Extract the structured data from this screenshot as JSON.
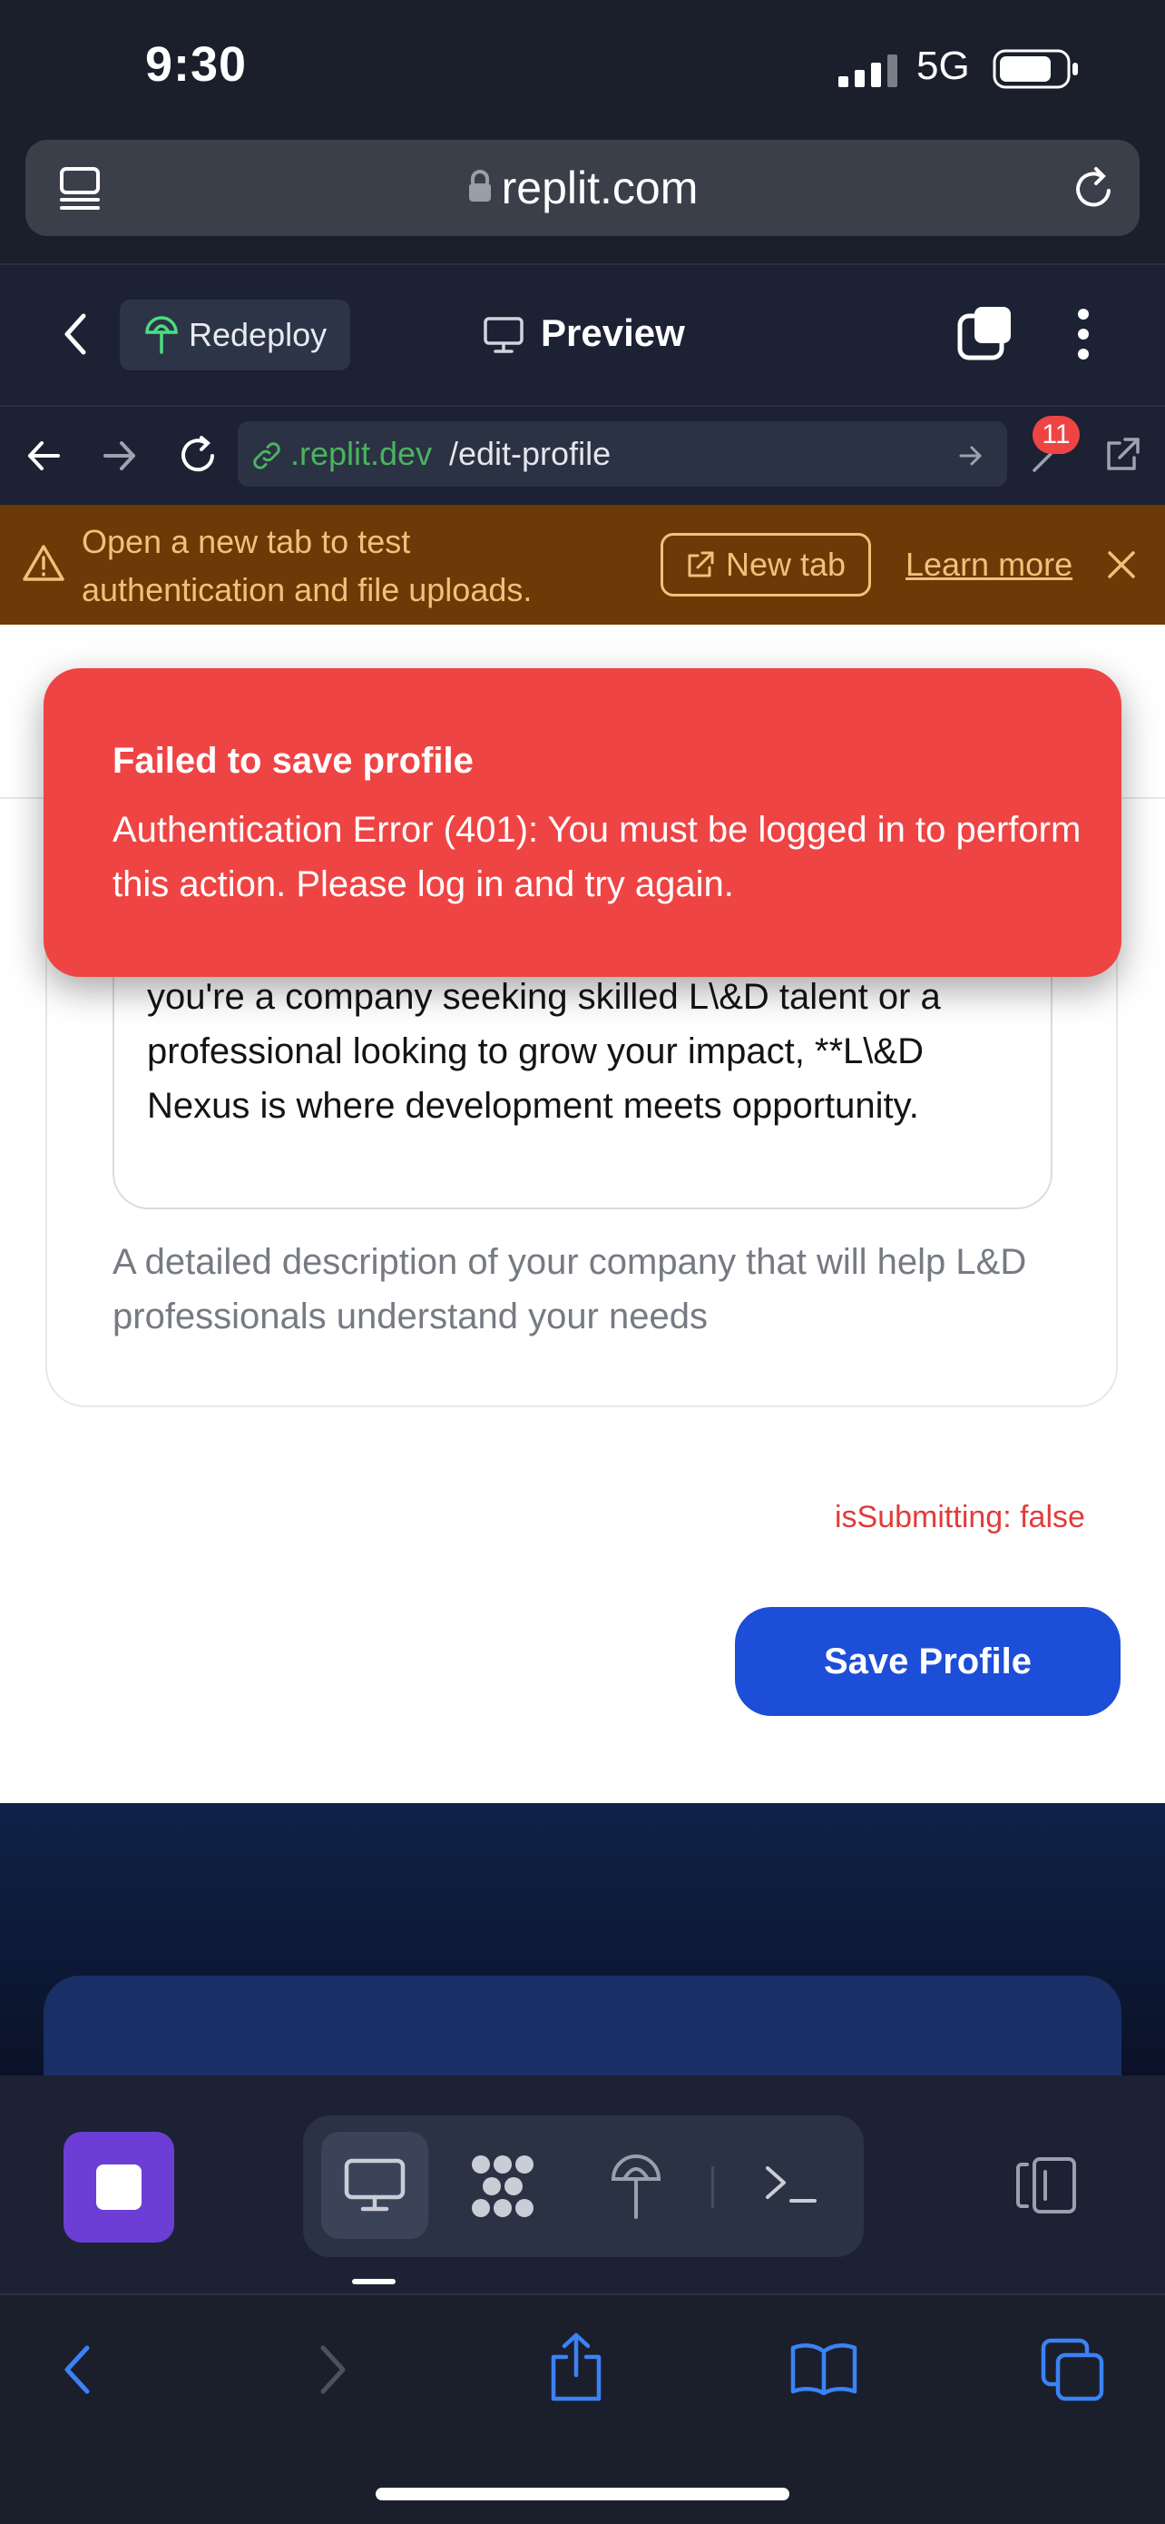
{
  "status_bar": {
    "time": "9:30",
    "network": "5G"
  },
  "safari": {
    "url": "replit.com"
  },
  "replit_header": {
    "redeploy_label": "Redeploy",
    "preview_label": "Preview"
  },
  "browser": {
    "domain": ".replit.dev",
    "path": "/edit-profile",
    "badge_count": "11"
  },
  "warning": {
    "line1": "Open a new tab to test",
    "line2": "authentication and file uploads.",
    "new_tab_label": "New tab",
    "learn_more_label": "Learn more"
  },
  "toast": {
    "title": "Failed to save profile",
    "message": "Authentication Error (401): You must be logged in to perform this action. Please log in and try again."
  },
  "form": {
    "description_text": "you're a company seeking skilled L\\&D talent or a professional looking to grow your impact, **L\\&D Nexus is where development meets opportunity.",
    "helper_text": "A detailed description of your company that will help L&D professionals understand your needs",
    "submitting_status": "isSubmitting: false",
    "save_label": "Save Profile"
  },
  "colors": {
    "toast_bg": "#ef4444",
    "primary_button": "#1d4ed8",
    "warning_bg": "#6b3a06",
    "warning_text": "#f2c07a",
    "link_green": "#4bb35f",
    "stop_purple": "#6c3ed6"
  },
  "icons": {
    "safari_bar": [
      "tabs-overview-icon",
      "lock-icon",
      "reload-icon"
    ],
    "replit_header": [
      "back-chevron-icon",
      "deploy-icon",
      "monitor-icon",
      "windows-icon",
      "more-vertical-icon"
    ],
    "browser_row": [
      "back-arrow-icon",
      "forward-arrow-icon",
      "refresh-icon",
      "link-icon",
      "go-arrow-icon",
      "wrench-icon",
      "external-link-icon"
    ],
    "warning": [
      "warning-triangle-icon",
      "external-link-icon",
      "close-icon"
    ],
    "toolbar": [
      "stop-square-icon",
      "monitor-icon",
      "workflows-icon",
      "deploy-icon",
      "terminal-icon",
      "split-panel-icon"
    ],
    "safari_bottom": [
      "back-chevron-icon",
      "forward-chevron-icon",
      "share-icon",
      "bookmarks-icon",
      "tabs-icon"
    ]
  }
}
